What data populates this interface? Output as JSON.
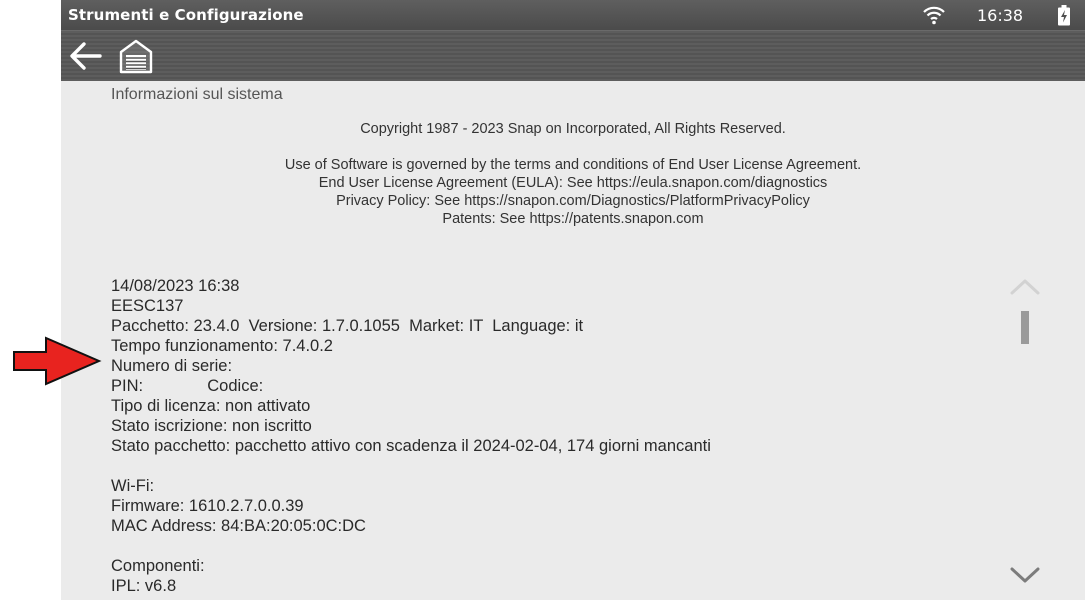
{
  "status_bar": {
    "title": "Strumenti e Configurazione",
    "time": "16:38",
    "wifi_icon": "wifi-icon",
    "battery_icon": "battery-charging-icon"
  },
  "toolbar": {
    "back_icon": "back-arrow-icon",
    "home_icon": "home-garage-icon"
  },
  "content": {
    "section_title": "Informazioni sul sistema",
    "copyright": "Copyright 1987 - 2023 Snap on Incorporated, All Rights Reserved.",
    "legal_lines": [
      "Use of Software is governed by the terms and conditions of End User License Agreement.",
      "End User License Agreement (EULA): See https://eula.snapon.com/diagnostics",
      "Privacy Policy: See https://snapon.com/Diagnostics/PlatformPrivacyPolicy",
      "Patents: See https://patents.snapon.com"
    ],
    "info_lines": [
      "14/08/2023 16:38",
      "EESC137",
      "Pacchetto: 23.4.0  Versione: 1.7.0.1055  Market: IT  Language: it",
      "Tempo funzionamento: 7.4.0.2",
      "Numero di serie: ",
      "PIN:              Codice:",
      "Tipo di licenza: non attivato",
      "Stato iscrizione: non iscritto",
      "Stato pacchetto: pacchetto attivo con scadenza il 2024-02-04, 174 giorni mancanti",
      "",
      "Wi-Fi:",
      "Firmware: 1610.2.7.0.0.39",
      "MAC Address: 84:BA:20:05:0C:DC",
      "",
      "Componenti:",
      "IPL: v6.8"
    ]
  },
  "colors": {
    "screen_bg": "#ebebeb",
    "status_bar": "#555555",
    "annotation_arrow": "#e8231f"
  }
}
